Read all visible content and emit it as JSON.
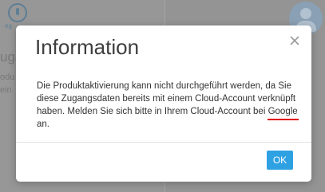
{
  "background": {
    "icon_name": "power-icon",
    "icon_label": "eg",
    "line_big": "ugang",
    "line_1": "odu",
    "line_2": "ein",
    "avatar_icon": "user-avatar-icon"
  },
  "dialog": {
    "title": "Information",
    "close_icon": "close-icon",
    "message_part1": "Die Produktaktivierung kann nicht durchgeführt werden, da Sie diese Zugangsdaten bereits mit einem Cloud-Account verknüpft haben. Melden Sie sich bitte in Ihrem Cloud-Account bei ",
    "message_highlight": "Google",
    "message_part2": " an.",
    "ok_label": "OK"
  },
  "colors": {
    "accent": "#2ea1e3",
    "highlight_underline": "#e00000",
    "overlay": "#9c9c9c"
  }
}
